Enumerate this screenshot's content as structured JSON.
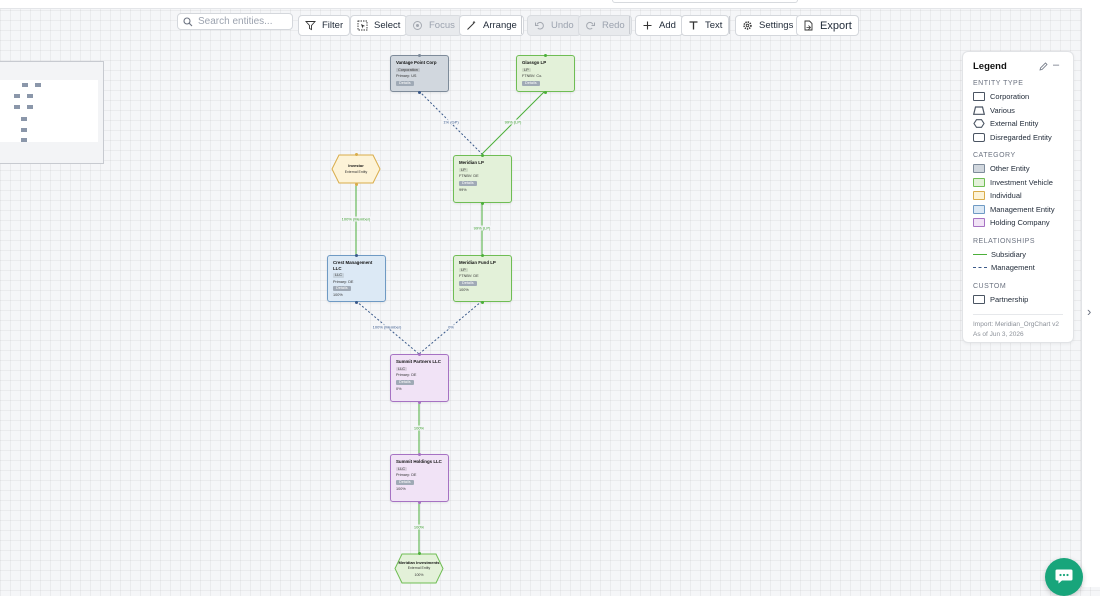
{
  "toolbar": {
    "search_placeholder": "Search entities...",
    "filter_label": "Filter",
    "select_label": "Select",
    "focus_label": "Focus",
    "arrange_label": "Arrange",
    "undo_label": "Undo",
    "redo_label": "Redo",
    "add_label": "Add",
    "text_label": "Text",
    "settings_label": "Settings",
    "export_label": "Export"
  },
  "nodes": {
    "vantage": {
      "title": "Vantage Point Corp",
      "tag": "Corporation",
      "line": "Primary: US",
      "button": "Details"
    },
    "glassgo": {
      "title": "Glassgo LP",
      "tag": "LP",
      "line": "FTNBV: Co.",
      "button": "Details"
    },
    "investor": {
      "title": "Investor",
      "subtitle": "External Entity"
    },
    "meridian_lp": {
      "title": "Meridian LP",
      "tag": "LP",
      "line": "FTNBV: DE",
      "button": "Details",
      "footer": "99%"
    },
    "meridian_fund": {
      "title": "Meridian Fund LP",
      "tag": "LP",
      "line": "FTNBV: DE",
      "button": "Details",
      "footer": "100%"
    },
    "crest": {
      "title": "Crest Management LLC",
      "tag": "LLC",
      "line": "Primary: DE",
      "button": "Details",
      "footer": "100%"
    },
    "summit_partners": {
      "title": "Summit Partners LLC",
      "tag": "LLC",
      "line": "Primary: DE",
      "button": "Details",
      "footer": "0%"
    },
    "summit_holdings": {
      "title": "Summit Holdings LLC",
      "tag": "LLC",
      "line": "Primary: DE",
      "button": "Details",
      "footer": "100%"
    },
    "meridian_investments": {
      "title": "Meridian Investments",
      "subtitle": "External Entity",
      "footer": "100%"
    }
  },
  "edges": {
    "vantage_meridian": "1% (GP)",
    "glassgo_meridian": "99% (LP)",
    "investor_crest": "100% (Member)",
    "meridian_lp_fund": "99% (LP)",
    "crest_summit": "100% (Member)",
    "fund_summit": "0%",
    "summit_holdings": "100%",
    "holdings_investments": "100%"
  },
  "legend": {
    "title": "Legend",
    "sections": {
      "entity_type": "ENTITY TYPE",
      "category": "CATEGORY",
      "relationships": "RELATIONSHIPS",
      "custom": "CUSTOM"
    },
    "entity_types": [
      "Corporation",
      "Various",
      "External Entity",
      "Disregarded Entity"
    ],
    "categories": [
      {
        "label": "Other Entity",
        "color": "#d1d7de"
      },
      {
        "label": "Investment Vehicle",
        "color": "#e3f1d9"
      },
      {
        "label": "Individual",
        "color": "#fdf3d7"
      },
      {
        "label": "Management Entity",
        "color": "#dce9f5"
      },
      {
        "label": "Holding Company",
        "color": "#f1e3f6"
      }
    ],
    "relationships": [
      "Subsidiary",
      "Management"
    ],
    "custom": [
      "Partnership"
    ],
    "import_text": "Import: Meridian_OrgChart v2",
    "as_of_text": "As of Jun 3, 2026"
  },
  "colors": {
    "subsidiary_edge": "#4caf3a",
    "management_edge": "#3b5a8a",
    "chat_button": "#18a57b"
  }
}
